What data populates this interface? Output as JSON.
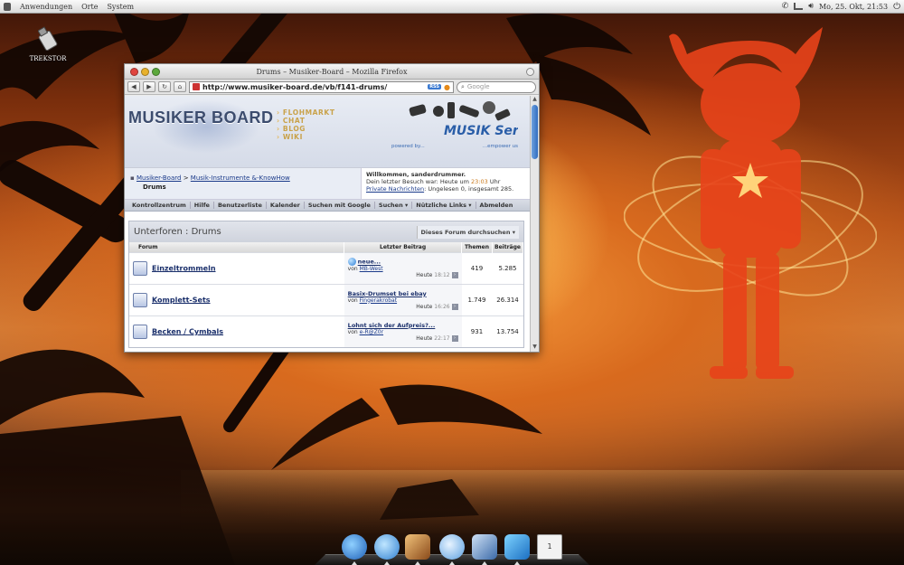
{
  "top_panel": {
    "menus": [
      "Anwendungen",
      "Orte",
      "System"
    ],
    "clock": "Mo, 25. Okt, 21:53"
  },
  "desktop": {
    "icon_label": "TREKSTOR"
  },
  "window": {
    "title": "Drums – Musiker-Board – Mozilla Firefox",
    "url": "http://www.musiker-board.de/vb/f141-drums/",
    "search_placeholder": "Google",
    "rss": "RSS"
  },
  "site": {
    "logo": "MUSIKER BOARD",
    "links": [
      "FLOHMARKT",
      "CHAT",
      "BLOG",
      "WIKI"
    ],
    "partner_logo": "MUSIK Service",
    "powered_left": "powered by...",
    "powered_right": "...empower us",
    "breadcrumb": {
      "root": "Musiker-Board",
      "sep": ">",
      "parent": "Musik-Instrumente &-KnowHow",
      "current": "Drums"
    },
    "welcome": {
      "line1": "Willkommen, sanderdrummer.",
      "line2_prefix": "Dein letzter Besuch war: Heute um",
      "line2_time": "23:03",
      "line2_suffix": "Uhr",
      "pm_link": "Private Nachrichten",
      "pm_suffix": ": Ungelesen 0, insgesamt 285."
    },
    "nav": [
      "Kontrollzentrum",
      "Hilfe",
      "Benutzerliste",
      "Kalender",
      "Suchen mit Google",
      "Suchen",
      "Nützliche Links",
      "Abmelden"
    ],
    "subforums": {
      "title": "Unterforen : Drums",
      "search_label": "Dieses Forum durchsuchen",
      "columns": [
        "Forum",
        "Letzter Beitrag",
        "Themen",
        "Beiträge"
      ],
      "rows": [
        {
          "name": "Einzeltrommeln",
          "last_title": "neue...",
          "by_prefix": "von",
          "by": "MB-West",
          "day": "Heute",
          "time": "18:12",
          "themes": "419",
          "posts": "5.285"
        },
        {
          "name": "Komplett-Sets",
          "last_title": "Basix-Drumset bei ebay",
          "by_prefix": "von",
          "by": "Fingerakrobat",
          "day": "Heute",
          "time": "16:26",
          "themes": "1.749",
          "posts": "26.314"
        },
        {
          "name": "Becken / Cymbals",
          "last_title": "Lohnt sich der Aufpreis?...",
          "by_prefix": "von",
          "by": "e-R@Z0r",
          "day": "Heute",
          "time": "22:17",
          "themes": "931",
          "posts": "13.754"
        }
      ]
    }
  },
  "dock": {
    "last_item_label": "1"
  },
  "colors": {
    "sky_glow": "#ffc35a",
    "mascot": "#e8431a",
    "link": "#1a3a8a"
  }
}
